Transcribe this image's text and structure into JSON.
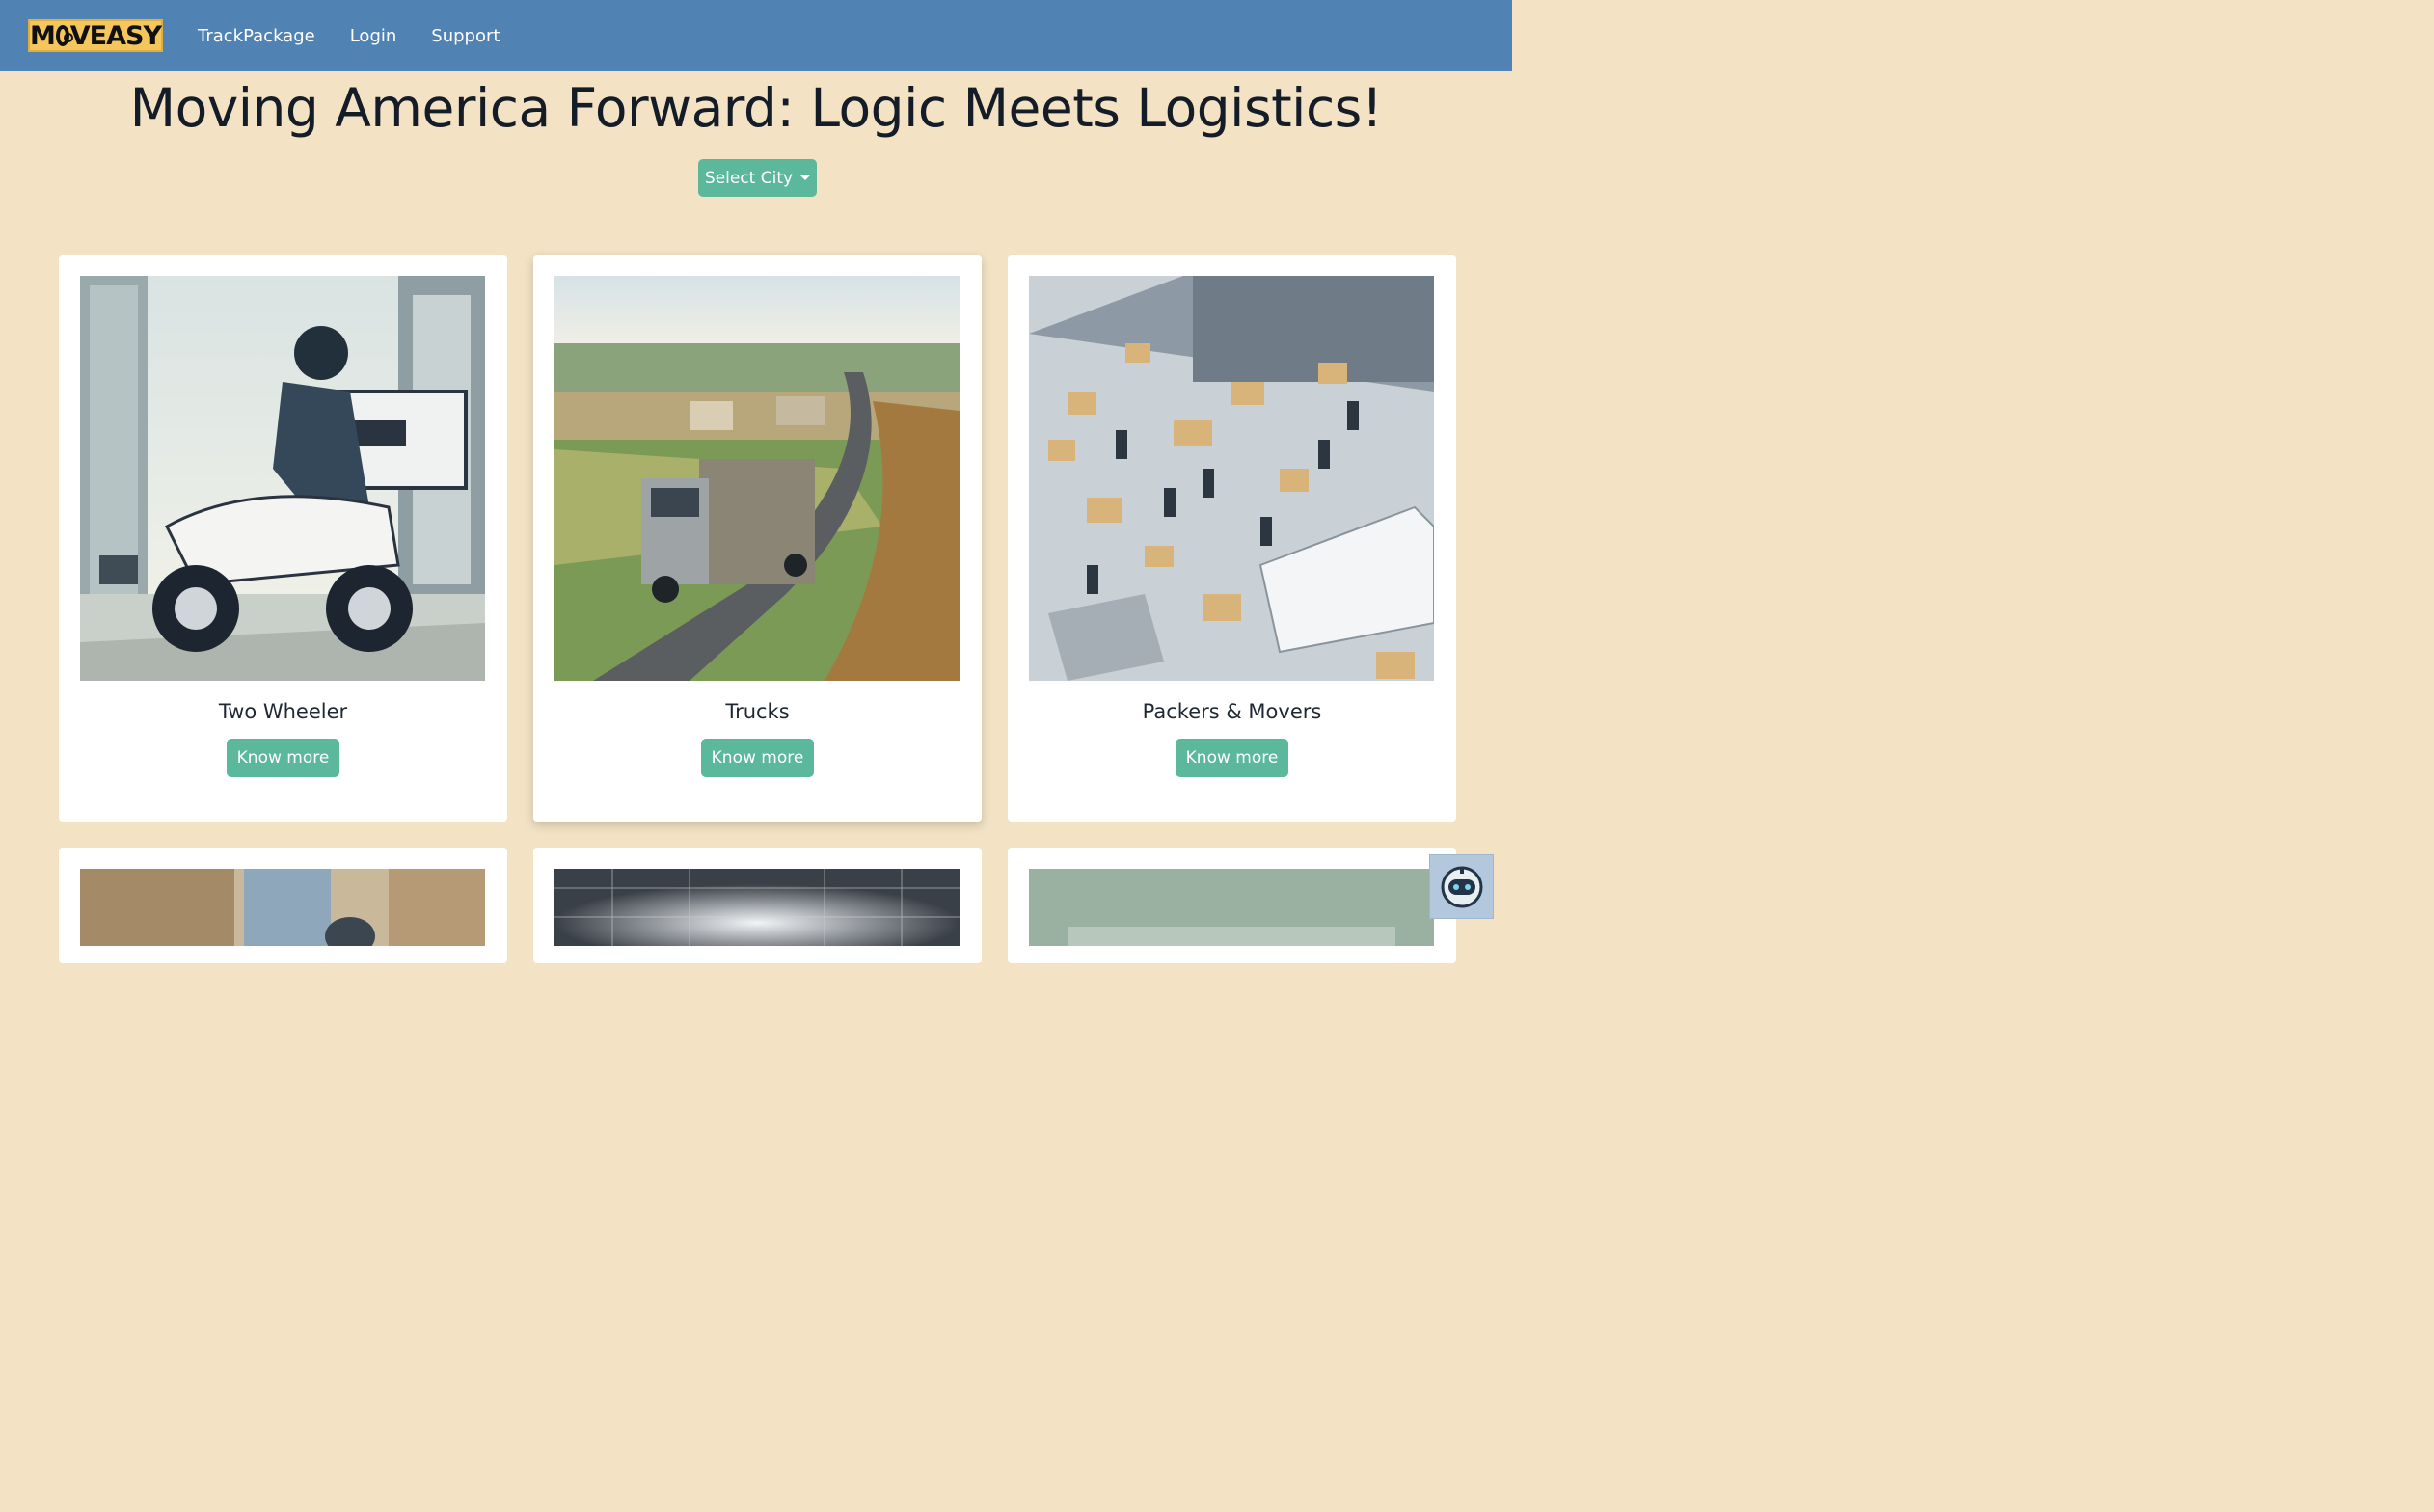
{
  "brand": {
    "logo_text": "MOVEASY"
  },
  "nav": {
    "links": [
      "TrackPackage",
      "Login",
      "Support"
    ]
  },
  "hero": {
    "title": "Moving America Forward: Logic Meets Logistics!",
    "city_button": "Select City"
  },
  "cards": [
    {
      "title": "Two Wheeler",
      "button": "Know more"
    },
    {
      "title": "Trucks",
      "button": "Know more"
    },
    {
      "title": "Packers & Movers",
      "button": "Know more"
    }
  ],
  "colors": {
    "navbar": "#5182b4",
    "background": "#f3e2c4",
    "accent": "#5bb89a",
    "logo": "#f5c65b"
  },
  "icons": {
    "dropdown": "caret-down-icon",
    "chatbot": "robot-icon"
  }
}
